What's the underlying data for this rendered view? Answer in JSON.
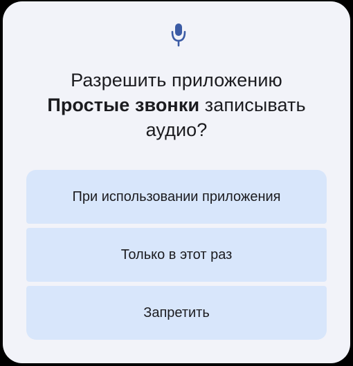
{
  "dialog": {
    "icon": "microphone-icon",
    "accent_color": "#3b5ba5",
    "title_prefix": "Разрешить приложению",
    "app_name": "Простые звонки",
    "title_verb": "записывать",
    "title_suffix": "аудио?",
    "buttons": [
      {
        "label": "При использовании приложения"
      },
      {
        "label": "Только в этот раз"
      },
      {
        "label": "Запретить"
      }
    ]
  }
}
